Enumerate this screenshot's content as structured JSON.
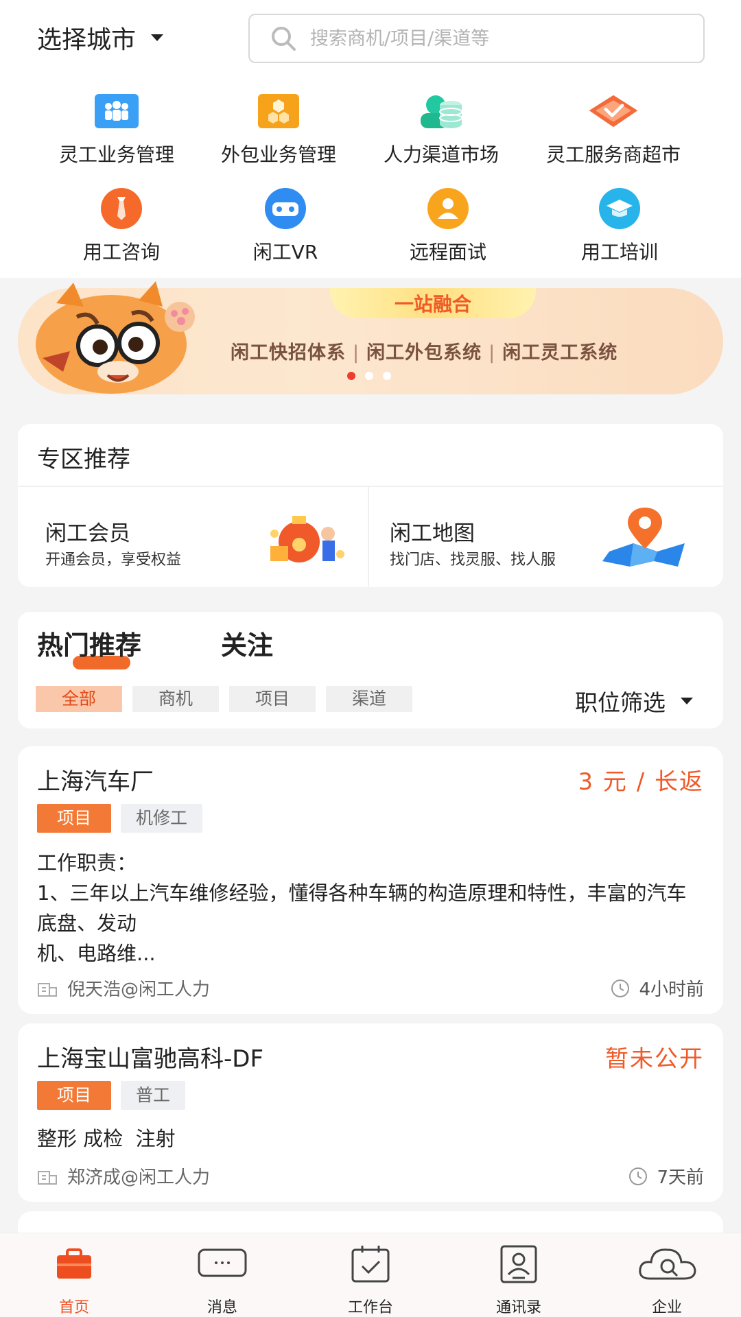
{
  "header": {
    "city_label": "选择城市",
    "search_placeholder": "搜索商机/项目/渠道等"
  },
  "quick_menu": [
    {
      "label": "灵工业务管理",
      "icon": "people-group-icon"
    },
    {
      "label": "外包业务管理",
      "icon": "boxes-icon"
    },
    {
      "label": "人力渠道市场",
      "icon": "database-icon"
    },
    {
      "label": "灵工服务商超市",
      "icon": "badge-check-icon"
    },
    {
      "label": "用工咨询",
      "icon": "tie-icon"
    },
    {
      "label": "闲工VR",
      "icon": "vr-headset-icon"
    },
    {
      "label": "远程面试",
      "icon": "person-icon"
    },
    {
      "label": "用工培训",
      "icon": "graduation-cap-icon"
    }
  ],
  "banner": {
    "headline": "一站融合",
    "items": [
      "闲工快招体系",
      "闲工外包系统",
      "闲工灵工系统"
    ],
    "separator": "|"
  },
  "zone": {
    "title": "专区推荐",
    "cards": [
      {
        "title": "闲工会员",
        "subtitle": "开通会员，享受权益"
      },
      {
        "title": "闲工地图",
        "subtitle": "找门店、找灵服、找人服"
      }
    ]
  },
  "hot": {
    "tabs": [
      "热门推荐",
      "关注"
    ],
    "filters": [
      "全部",
      "商机",
      "项目",
      "渠道"
    ],
    "position_filter": "职位筛选"
  },
  "listings": [
    {
      "title": "上海汽车厂",
      "price": "3 元 / 长返",
      "tags": [
        "项目",
        "机修工"
      ],
      "description": "工作职责：\n1、三年以上汽车维修经验，懂得各种车辆的构造原理和特性，丰富的汽车底盘、发动\n机、电路维...",
      "author": "倪天浩@闲工人力",
      "time": "4小时前"
    },
    {
      "title": "上海宝山富驰高科-DF",
      "price": "暂未公开",
      "tags": [
        "项目",
        "普工"
      ],
      "description": "整形 成检  注射",
      "author": "郑济成@闲工人力",
      "time": "7天前"
    }
  ],
  "tabbar": [
    {
      "label": "首页",
      "icon": "briefcase-icon",
      "active": true
    },
    {
      "label": "消息",
      "icon": "message-icon",
      "active": false
    },
    {
      "label": "工作台",
      "icon": "calendar-check-icon",
      "active": false
    },
    {
      "label": "通讯录",
      "icon": "contact-icon",
      "active": false
    },
    {
      "label": "企业",
      "icon": "cloud-search-icon",
      "active": false
    }
  ],
  "colors": {
    "accent": "#f05a28",
    "tag": "#f37a36"
  }
}
